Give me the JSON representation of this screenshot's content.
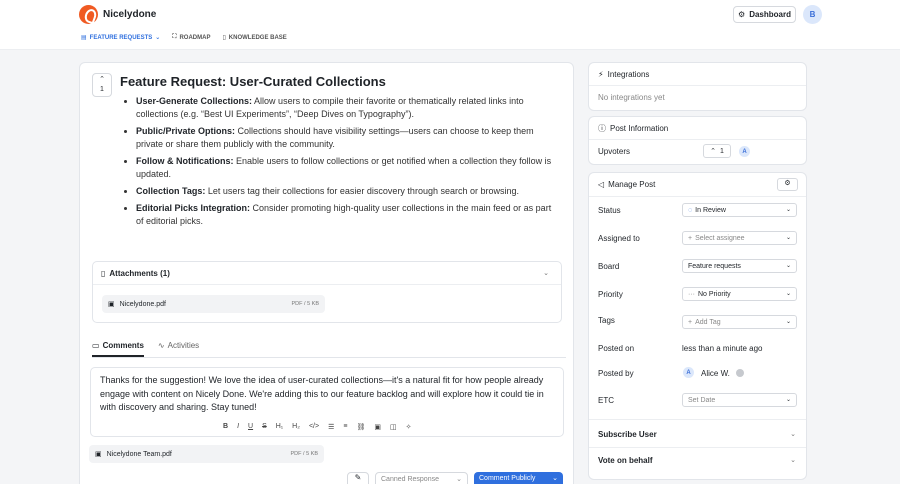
{
  "brand": "Nicelydone",
  "header": {
    "dashboard": "Dashboard",
    "avatar": "B"
  },
  "nav": {
    "feature_requests": "FEATURE REQUESTS",
    "roadmap": "ROADMAP",
    "knowledge_base": "KNOWLEDGE BASE"
  },
  "post": {
    "votes": "1",
    "title": "Feature Request: User-Curated Collections",
    "bullets": [
      {
        "label": "User-Generate Collections:",
        "text": " Allow users to compile their favorite or thematically related links into collections (e.g. “Best UI Experiments”, “Deep Dives on Typography”)."
      },
      {
        "label": "Public/Private Options:",
        "text": " Collections should have visibility settings—users can choose to keep them private or share them publicly with the community."
      },
      {
        "label": "Follow & Notifications:",
        "text": " Enable users to follow collections or get notified when a collection they follow is updated."
      },
      {
        "label": "Collection Tags:",
        "text": " Let users tag their collections for easier discovery through search or browsing."
      },
      {
        "label": "Editorial Picks Integration:",
        "text": " Consider promoting high-quality user collections in the main feed or as part of editorial picks."
      }
    ]
  },
  "attachments": {
    "title": "Attachments (1)",
    "file_name": "Nicelydone.pdf",
    "file_meta": "PDF / 5 KB"
  },
  "comments": {
    "tab_comments": "Comments",
    "tab_activities": "Activities",
    "draft": "Thanks for the suggestion! We love the idea of user-curated collections—it's a natural fit for how people already engage with content on Nicely Done. We're adding this to our feature backlog and will explore how it could tie in with discovery and sharing. Stay tuned!",
    "file_name": "Nicelydone Team.pdf",
    "file_meta": "PDF / 5 KB",
    "canned": "Canned Response",
    "publish": "Comment Publicly"
  },
  "sidebar": {
    "integrations_title": "Integrations",
    "integrations_empty": "No integrations yet",
    "post_info_title": "Post Information",
    "upvoters_label": "Upvoters",
    "upvote_count": "1",
    "upvoter_avatar": "A",
    "manage_title": "Manage Post",
    "status_label": "Status",
    "status_value": "In Review",
    "assigned_label": "Assigned to",
    "assigned_value": "Select assignee",
    "board_label": "Board",
    "board_value": "Feature requests",
    "priority_label": "Priority",
    "priority_value": "No Priority",
    "tags_label": "Tags",
    "tags_value": "Add Tag",
    "posted_on_label": "Posted on",
    "posted_on_value": "less than a minute ago",
    "posted_by_label": "Posted by",
    "posted_by_avatar": "A",
    "posted_by_value": "Alice W.",
    "etc_label": "ETC",
    "etc_value": "Set Date",
    "subscribe_label": "Subscribe User",
    "vote_behalf_label": "Vote on behalf"
  }
}
